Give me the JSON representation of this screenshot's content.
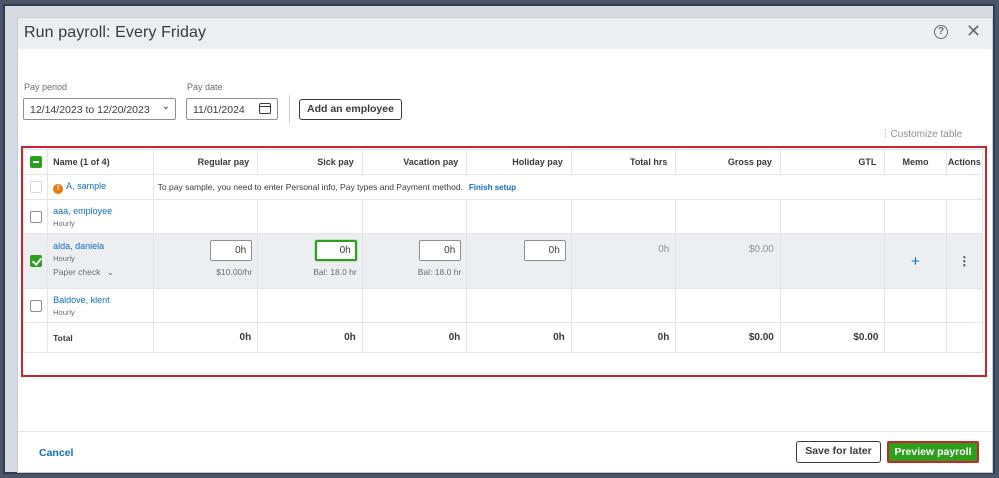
{
  "dialog": {
    "title": "Run payroll: Every Friday"
  },
  "filters": {
    "pay_period_label": "Pay period",
    "pay_period_value": "12/14/2023 to 12/20/2023",
    "pay_date_label": "Pay date",
    "pay_date_value": "11/01/2024",
    "add_employee_label": "Add an employee",
    "customize_label": "Customize table"
  },
  "table": {
    "headers": {
      "name": "Name (1 of 4)",
      "regular": "Regular pay",
      "sick": "Sick pay",
      "vacation": "Vacation pay",
      "holiday": "Holiday pay",
      "total_hrs": "Total hrs",
      "gross": "Gross pay",
      "gtl": "GTL",
      "memo": "Memo",
      "actions": "Actions"
    },
    "rows": [
      {
        "name": "A, sample",
        "message": "To pay sample, you need to enter Personal info, Pay types and Payment method.",
        "message_link": "Finish setup"
      },
      {
        "name": "aaa, employee",
        "type": "Hourly"
      },
      {
        "name": "alda, daniela",
        "type": "Hourly",
        "payment": "Paper check",
        "regular": "0h",
        "regular_rate": "$10.00/hr",
        "sick": "0h",
        "sick_bal": "Bal: 18.0 hr",
        "vacation": "0h",
        "vacation_bal": "Bal: 18.0 hr",
        "holiday": "0h",
        "total_hrs": "0h",
        "gross": "$0.00"
      },
      {
        "name": "Baldove, klent",
        "type": "Hourly"
      }
    ],
    "total": {
      "label": "Total",
      "regular": "0h",
      "sick": "0h",
      "vacation": "0h",
      "holiday": "0h",
      "total_hrs": "0h",
      "gross": "$0.00",
      "gtl": "$0.00"
    }
  },
  "footer": {
    "cancel_label": "Cancel",
    "save_label": "Save for later",
    "preview_label": "Preview payroll"
  },
  "colors": {
    "accent": "#2ca01c",
    "link": "#0d6ebd",
    "highlight": "#c9252c",
    "warning": "#e47d0e"
  },
  "icons": [
    "help-icon",
    "close-icon",
    "chevron-down-icon",
    "calendar-icon",
    "sliders-icon",
    "warning-icon",
    "plus-icon",
    "more-vertical-icon"
  ]
}
